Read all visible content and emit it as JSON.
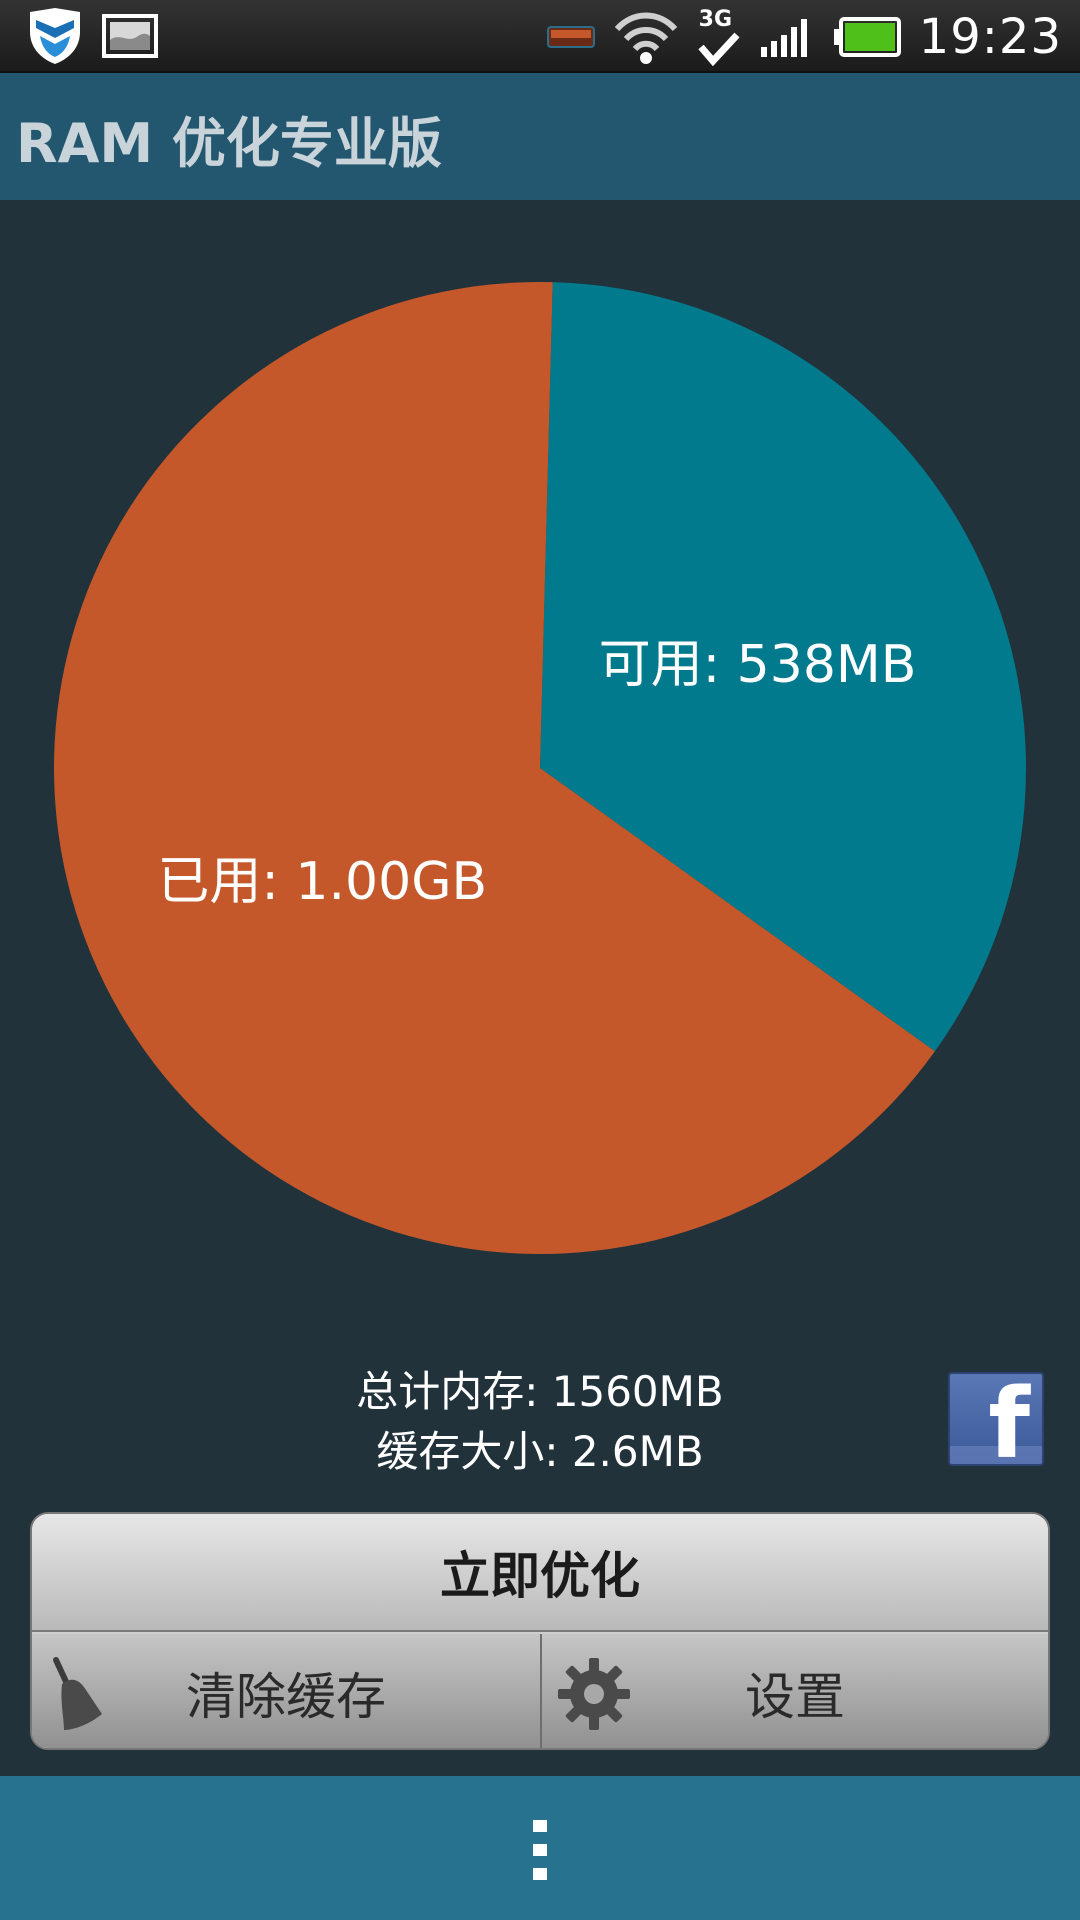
{
  "status_bar": {
    "time": "19:23",
    "network": "3G",
    "icons": [
      "shield-app-icon",
      "picture-notification-icon",
      "battery-saver-icon",
      "wifi-icon",
      "3g-data-icon",
      "signal-icon",
      "battery-icon"
    ]
  },
  "app": {
    "title": "RAM 优化专业版"
  },
  "chart_data": {
    "type": "pie",
    "slices": [
      {
        "label": "可用: 538MB",
        "value": 538,
        "color": "#007a8c"
      },
      {
        "label": "已用: 1.00GB",
        "value": 1022,
        "color": "#c5582a"
      }
    ]
  },
  "info": {
    "total_memory": "总计内存: 1560MB",
    "cache_size": "缓存大小: 2.6MB"
  },
  "buttons": {
    "optimize": "立即优化",
    "clear_cache": "清除缓存",
    "settings": "设置"
  },
  "social": {
    "facebook_glyph": "f"
  },
  "colors": {
    "background": "#22323a",
    "app_bar": "#23566f",
    "bottom_bar": "#27728f",
    "used": "#c5582a",
    "free": "#007a8c"
  }
}
